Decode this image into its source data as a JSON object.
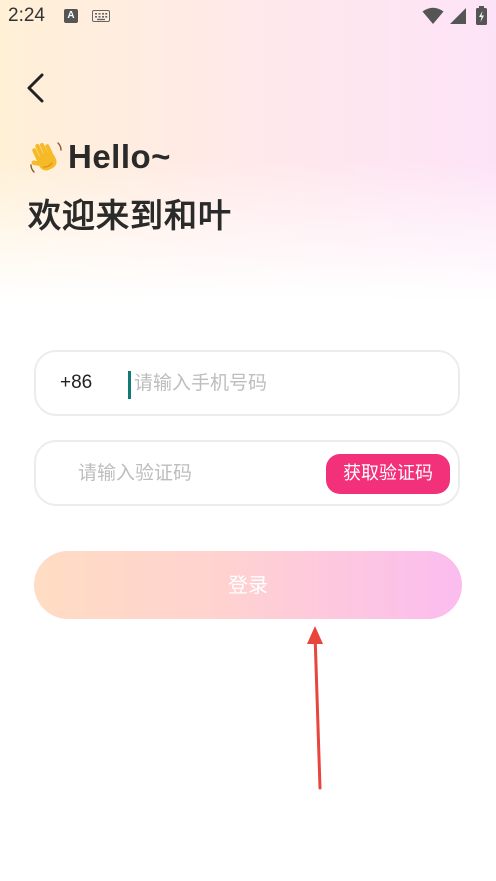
{
  "status_bar": {
    "time": "2:24",
    "a_icon_text": "A",
    "icons": [
      "a-icon",
      "keyboard-icon",
      "wifi-icon",
      "signal-icon",
      "battery-icon"
    ]
  },
  "header": {
    "back_icon": "chevron-left-icon",
    "wave_icon": "waving-hand-icon",
    "greeting": "Hello~",
    "welcome": "欢迎来到和叶"
  },
  "form": {
    "country_code": "+86",
    "phone_placeholder": "请输入手机号码",
    "code_placeholder": "请输入验证码",
    "get_code_label": "获取验证码",
    "login_label": "登录"
  },
  "colors": {
    "accent": "#f3307a",
    "caret": "#117a74",
    "login_gradient_start": "#ffdcc3",
    "login_gradient_end": "#fbbcef",
    "annotation": "#e8453c"
  }
}
